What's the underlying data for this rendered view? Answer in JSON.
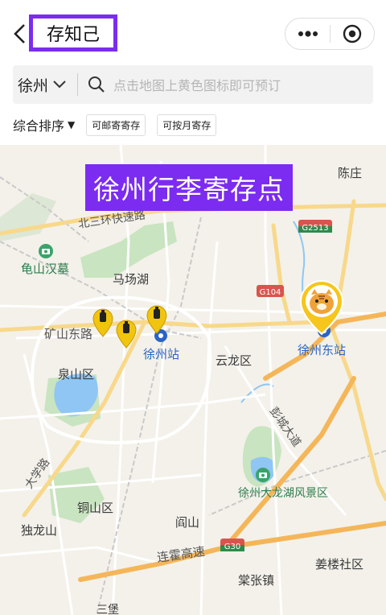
{
  "header": {
    "title": "存知己",
    "more_icon": "more-dots-icon",
    "close_icon": "target-close-icon"
  },
  "search": {
    "city": "徐州",
    "placeholder": "点击地图上黄色图标即可预订"
  },
  "filters": {
    "sort_label": "综合排序",
    "sort_arrow": "▼",
    "tags": [
      "可邮寄寄存",
      "可按月寄存"
    ]
  },
  "banner": {
    "text": "徐州行李寄存点"
  },
  "map": {
    "labels": {
      "chenzhuang": "陈庄",
      "beisanhuan": "北三环快速路",
      "g2513": "G2513",
      "guishan": "龟山汉墓",
      "machanghu": "马场湖",
      "g104": "G104",
      "kuangshan": "矿山东路",
      "xuzhouzhan": "徐州站",
      "yunlong": "云龙区",
      "xuzhoudong": "徐州东站",
      "quanshan": "泉山区",
      "pengcheng": "彭城大道",
      "tuanjie": "大学路",
      "dalonghu": "徐州大龙湖风景区",
      "tongshan": "铜山区",
      "dulongshan": "独龙山",
      "yanshan": "阎山",
      "lianhuo": "连霍高速",
      "g30": "G30",
      "jianglou": "姜楼社区",
      "dazhang": "棠张镇",
      "sanbao": "三堡"
    }
  }
}
